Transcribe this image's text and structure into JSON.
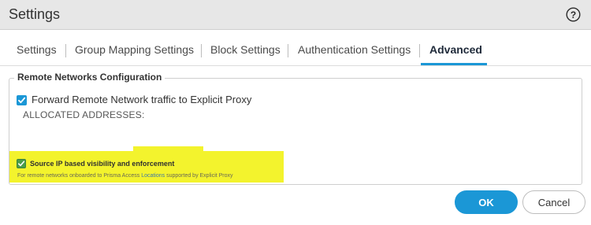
{
  "dialog": {
    "title": "Settings",
    "help_icon": "help-circle-icon"
  },
  "tabs": [
    {
      "label": "Settings",
      "active": false
    },
    {
      "label": "Group Mapping Settings",
      "active": false
    },
    {
      "label": "Block Settings",
      "active": false
    },
    {
      "label": "Authentication Settings",
      "active": false
    },
    {
      "label": "Advanced",
      "active": true
    }
  ],
  "remote_networks": {
    "legend": "Remote Networks Configuration",
    "forward_checkbox": {
      "label": "Forward Remote Network traffic to Explicit Proxy",
      "checked": true
    },
    "allocated_label": "ALLOCATED ADDRESSES:",
    "source_ip_checkbox": {
      "label": "Source IP based visibility and enforcement",
      "checked": true
    },
    "hint_prefix": "For remote networks onboarded to Prisma Access ",
    "hint_link": "Locations",
    "hint_suffix": " supported by Explicit Proxy"
  },
  "buttons": {
    "ok": "OK",
    "cancel": "Cancel"
  },
  "colors": {
    "accent": "#1b97d6",
    "highlight": "#f3f32d",
    "checkbox_green": "#4a9d4a"
  }
}
